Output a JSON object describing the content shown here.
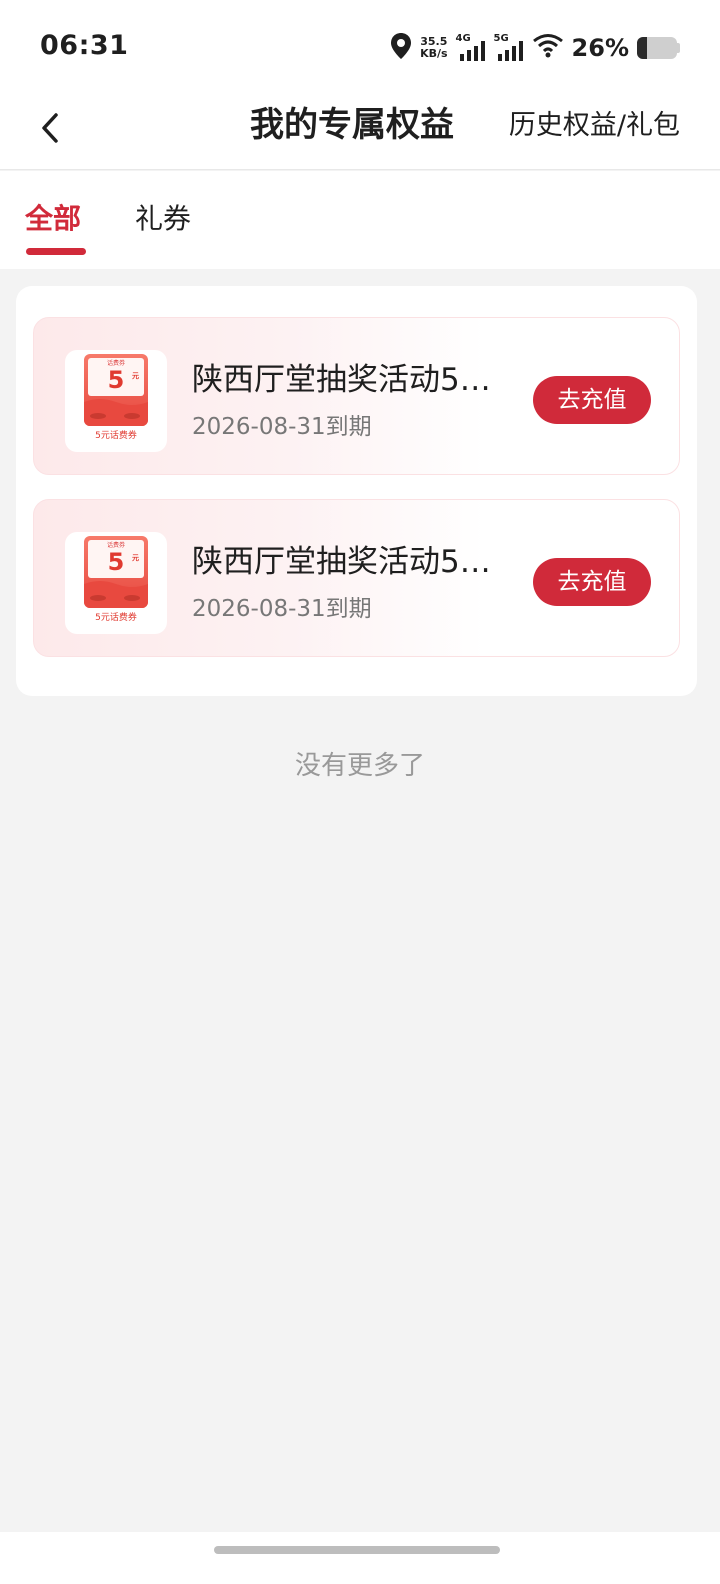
{
  "status_bar": {
    "time": "06:31",
    "speed_value": "35.5",
    "speed_unit": "KB/s",
    "net1": "4G",
    "net2": "5G",
    "battery_pct": "26%",
    "battery_level": 0.26
  },
  "header": {
    "title": "我的专属权益",
    "history_link": "历史权益/礼包"
  },
  "tabs": [
    {
      "label": "全部",
      "active": true
    },
    {
      "label": "礼券",
      "active": false
    }
  ],
  "coupons": [
    {
      "title": "陕西厅堂抽奖活动5…",
      "expiry": "2026-08-31到期",
      "action": "去充值",
      "thumb_top": "话费券",
      "thumb_value": "5",
      "thumb_unit": "元",
      "thumb_caption": "5元话费券"
    },
    {
      "title": "陕西厅堂抽奖活动5…",
      "expiry": "2026-08-31到期",
      "action": "去充值",
      "thumb_top": "话费券",
      "thumb_value": "5",
      "thumb_unit": "元",
      "thumb_caption": "5元话费券"
    }
  ],
  "footer_text": "没有更多了",
  "colors": {
    "accent": "#d02a3a",
    "background": "#f3f3f3"
  }
}
